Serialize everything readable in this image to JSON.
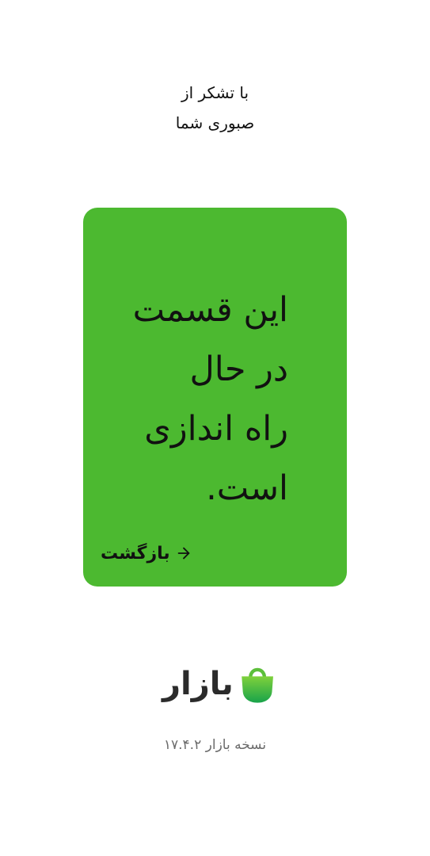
{
  "thanks": {
    "line1": "با تشکر از",
    "line2": "صبوری شما"
  },
  "card": {
    "message_lines": [
      "این قسمت",
      "در حال",
      "راه اندازی",
      "است."
    ],
    "back_label": "بازگشت",
    "back_icon": "arrow-right-icon",
    "background": "#4cb930"
  },
  "brand": {
    "wordmark": "بازار",
    "logo_icon": "shopping-bag-icon",
    "logo_colors": [
      "#7fd13b",
      "#18a34a"
    ]
  },
  "footer": {
    "version": "نسخه بازار ۱۷.۴.۲"
  }
}
